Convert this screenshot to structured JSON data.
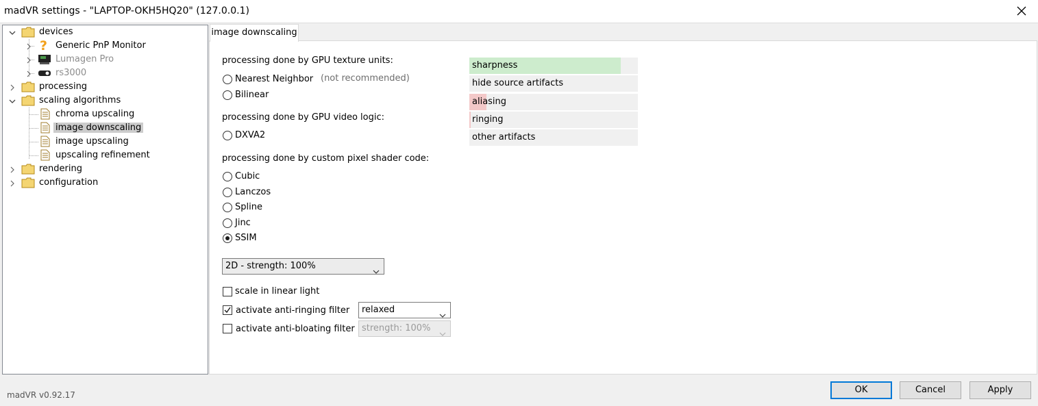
{
  "window": {
    "title": "madVR settings - \"LAPTOP-OKH5HQ20\" (127.0.0.1)"
  },
  "tree": {
    "devices": "devices",
    "generic_pnp": "Generic PnP Monitor",
    "lumagen": "Lumagen Pro",
    "rs3000": "rs3000",
    "processing": "processing",
    "scaling": "scaling algorithms",
    "chroma": "chroma upscaling",
    "downscaling": "image downscaling",
    "upscaling": "image upscaling",
    "refinement": "upscaling refinement",
    "rendering": "rendering",
    "configuration": "configuration"
  },
  "tab": {
    "label": "image downscaling"
  },
  "sections": {
    "texture": "processing done by GPU texture units:",
    "video_logic": "processing done by GPU video logic:",
    "shader": "processing done by custom pixel shader code:"
  },
  "options": {
    "nearest": "Nearest Neighbor",
    "nearest_hint": "(not recommended)",
    "bilinear": "Bilinear",
    "dxva2": "DXVA2",
    "cubic": "Cubic",
    "lanczos": "Lanczos",
    "spline": "Spline",
    "jinc": "Jinc",
    "ssim": "SSIM",
    "selected": "SSIM"
  },
  "strength_select": {
    "value": "2D - strength: 100%"
  },
  "checkboxes": {
    "linear_light": {
      "label": "scale in linear light",
      "checked": false
    },
    "anti_ringing": {
      "label": "activate anti-ringing filter",
      "checked": true,
      "select_value": "relaxed"
    },
    "anti_bloating": {
      "label": "activate anti-bloating filter",
      "checked": false,
      "select_value": "strength: 100%"
    }
  },
  "quality_bars": [
    {
      "label": "sharpness",
      "level": 0.9,
      "color": "#cdeccd"
    },
    {
      "label": "hide source artifacts",
      "level": 0.0,
      "color": "#cdeccd"
    },
    {
      "label": "aliasing",
      "level": 0.1,
      "color": "#f3c8c8"
    },
    {
      "label": "ringing",
      "level": 0.01,
      "color": "#f3c8c8"
    },
    {
      "label": "other artifacts",
      "level": 0.0,
      "color": "#cdeccd"
    }
  ],
  "footer": {
    "version": "madVR v0.92.17",
    "ok": "OK",
    "cancel": "Cancel",
    "apply": "Apply"
  },
  "colors": {
    "accent": "#0078d7",
    "folder": "#f2d275",
    "selection": "#cccccc"
  }
}
